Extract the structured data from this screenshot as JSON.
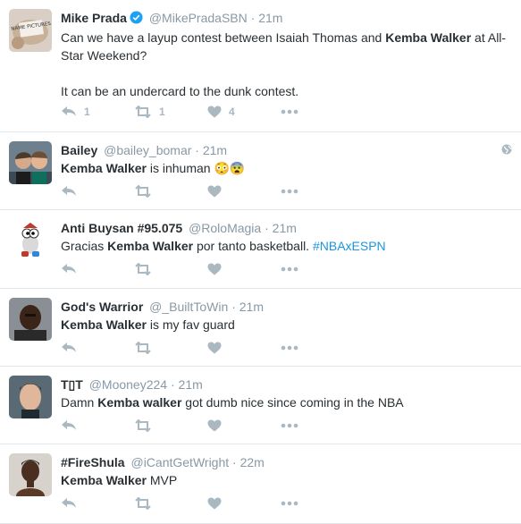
{
  "tweets": [
    {
      "fullname": "Mike Prada",
      "verified": true,
      "screen_name": "@MikePradaSBN",
      "time": "21m",
      "text_parts": [
        "Can we have a layup contest between Isaiah Thomas and ",
        "Kemba Walker",
        " at All-Star Weekend?"
      ],
      "text_line2": "It can be an undercard to the dunk contest.",
      "reply_count": "1",
      "retweet_count": "1",
      "like_count": "4",
      "avatar_text": "NAME PICTURES"
    },
    {
      "fullname": "Bailey",
      "screen_name": "@bailey_bomar",
      "time": "21m",
      "text_parts": [
        "Kemba Walker",
        " is inhuman ",
        "😳😨"
      ],
      "globe_icon": "globe-icon"
    },
    {
      "fullname": "Anti Buysan #95.075",
      "screen_name": "@RoloMagia",
      "time": "21m",
      "text_parts": [
        "Gracias ",
        "Kemba Walker",
        " por tanto basketball. ",
        "#NBAxESPN"
      ]
    },
    {
      "fullname": "God's Warrior",
      "screen_name": "@_BuiltToWin",
      "time": "21m",
      "text_parts": [
        "Kemba Walker",
        " is my fav guard"
      ]
    },
    {
      "fullname": "T▯T",
      "screen_name": "@Mooney224",
      "time": "21m",
      "text_parts": [
        "Damn ",
        "Kemba walker",
        " got dumb nice since coming in the NBA"
      ]
    },
    {
      "fullname": "#FireShula",
      "screen_name": "@iCantGetWright",
      "time": "22m",
      "text_parts": [
        "Kemba Walker",
        " MVP"
      ]
    }
  ],
  "separator": "·",
  "colors": {
    "accent": "#1b95e0",
    "muted": "#8899a6",
    "icon": "#aab8c2",
    "verified": "#1da1f2"
  }
}
